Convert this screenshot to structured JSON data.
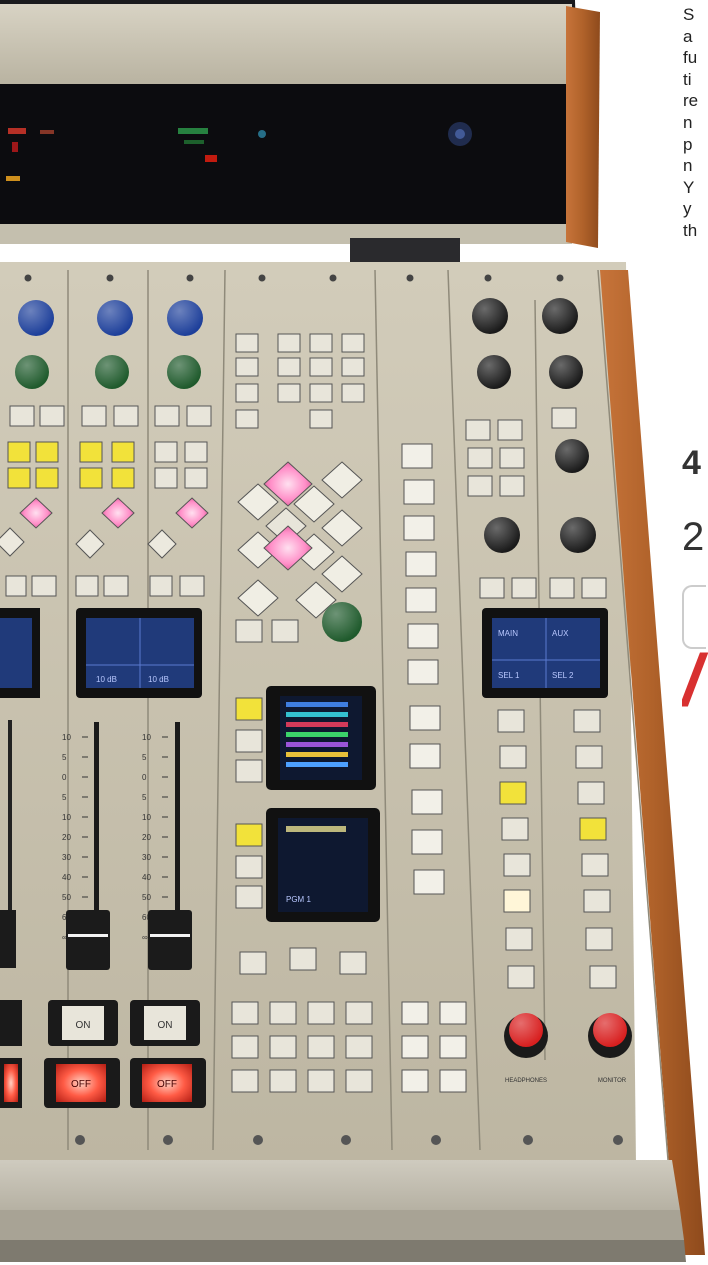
{
  "scene": {
    "description_colors": {
      "panel": "#c9c3b0",
      "wood": "#b8662e",
      "meter_bridge": "#0d0d10",
      "button_yellow": "#f2e23a",
      "button_red": "#ff4a3a",
      "button_pink": "#ff9ad0",
      "knob_blue": "#1d3f9a",
      "knob_green": "#1f5a2c",
      "knob_black": "#1a1a1a",
      "knob_red": "#d81f1f",
      "screen_blue": "#203a7a"
    }
  },
  "side_text_lines": [
    "S",
    "a",
    "fu",
    "ti",
    "re",
    "n",
    "p",
    "n",
    "Y",
    "y",
    "th"
  ],
  "side_fragments": {
    "f1": "4",
    "f2": "2",
    "f3": "/"
  },
  "console": {
    "on_label": "ON",
    "off_label": "OFF",
    "headphones_label": "HEADPHONES",
    "monitor_label": "MONITOR",
    "fader_scale": [
      "10",
      "5",
      "0",
      "5",
      "10",
      "20",
      "30",
      "40",
      "50",
      "60",
      "∞"
    ]
  },
  "screens": {
    "ch2_left": "10 dB",
    "ch2_right": "10 dB",
    "mon_left": "MAIN",
    "mon_right": "AUX",
    "mon_b1": "SEL 1",
    "mon_b2": "SEL 2",
    "center_lower": "PGM 1"
  }
}
